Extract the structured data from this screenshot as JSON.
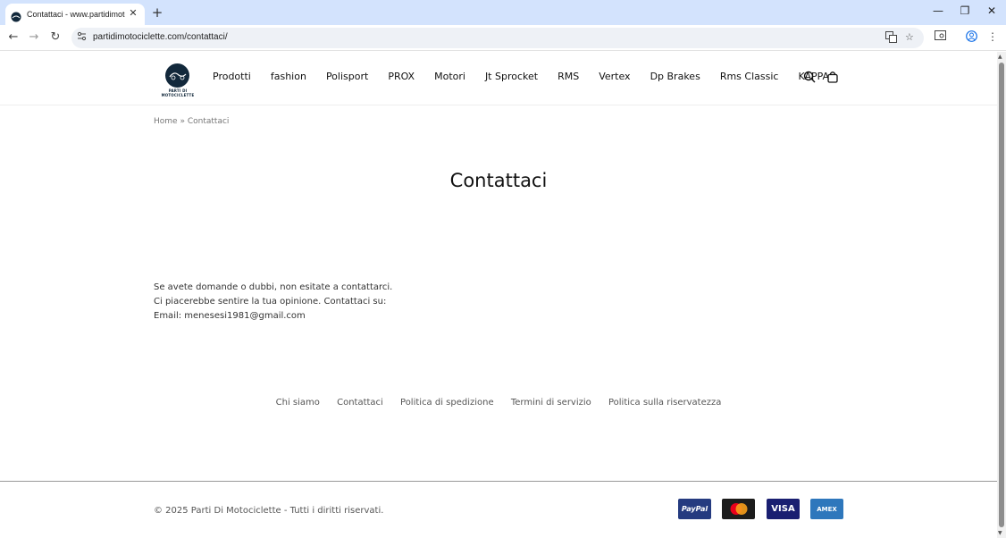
{
  "browser": {
    "tab_title": "Contattaci - www.partidimotoc",
    "tab_close": "✕",
    "new_tab": "+",
    "url": "partidimotociclette.com/contattaci/",
    "controls": {
      "minimize": "—",
      "restore": "❐",
      "close": "✕"
    },
    "nav": {
      "back": "←",
      "forward": "→",
      "reload": "↻"
    }
  },
  "site": {
    "logo_text": "PARTI DI MOTOCICLETTE",
    "menu": [
      "Prodotti",
      "fashion",
      "Polisport",
      "PROX",
      "Motori",
      "Jt Sprocket",
      "RMS",
      "Vertex",
      "Dp Brakes",
      "Rms Classic",
      "KAPPA"
    ]
  },
  "breadcrumb": {
    "home": "Home",
    "separator": "»",
    "current": "Contattaci"
  },
  "page_title": "Contattaci",
  "content": {
    "line1": "Se avete domande o dubbi, non esitate a contattarci.",
    "line2": "Ci piacerebbe sentire la tua opinione. Contattaci su:",
    "line3": "Email: menesesi1981@gmail.com"
  },
  "footer": {
    "links": [
      "Chi siamo",
      "Contattaci",
      "Politica di spedizione",
      "Termini di servizio",
      "Politica sulla riservatezza"
    ],
    "copyright": "© 2025 Parti Di Motociclette - Tutti i diritti riservati.",
    "payments": [
      "PayPal",
      "VISA",
      "AMEX"
    ]
  },
  "colors": {
    "accent_navy": "#12283b",
    "tab_strip": "#d3e3fd",
    "visa": "#1a1f71",
    "amex": "#2e77bc"
  }
}
